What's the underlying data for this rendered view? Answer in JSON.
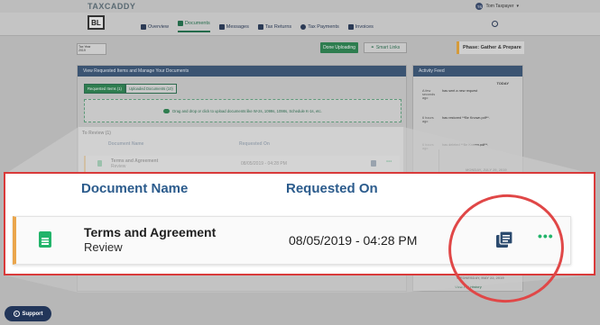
{
  "app": {
    "logo_text": "TAXCADDY",
    "firm_badge": "BL"
  },
  "user": {
    "initials": "TS",
    "name": "Tom Taxpayer"
  },
  "nav": {
    "items": [
      {
        "label": "Overview",
        "active": false
      },
      {
        "label": "Documents",
        "active": true
      },
      {
        "label": "Messages",
        "active": false
      },
      {
        "label": "Tax Returns",
        "active": false
      },
      {
        "label": "Tax Payments",
        "active": false
      },
      {
        "label": "Invoices",
        "active": false
      }
    ]
  },
  "subbar": {
    "tax_year_label": "Tax Year",
    "tax_year_value": "2019",
    "done_uploading": "Done Uploading",
    "smart_links": "Smart Links",
    "phase": "Phase: Gather & Prepare"
  },
  "main": {
    "header": "View Requested Items and Manage Your Documents",
    "tabs": [
      {
        "label": "Requested Items (1)",
        "active": true
      },
      {
        "label": "Uploaded Documents (10)",
        "active": false
      }
    ],
    "dropzone_text": "Drag and drop or click to upload documents like W-2s, 1099s, 1098s, Schedule K-1s, etc.",
    "to_review_title": "To Review (1)",
    "columns": {
      "document_name": "Document Name",
      "requested_on": "Requested On"
    },
    "rows": [
      {
        "name": "Terms and Agreement",
        "subtitle": "Review",
        "requested_on": "08/05/2019 - 04:28 PM"
      }
    ]
  },
  "activity": {
    "header": "Activity Feed",
    "today_label": "TODAY",
    "items": [
      {
        "time": "A few seconds ago",
        "text": "has sent a new request"
      },
      {
        "time": "6 hours ago",
        "text": "has restored **Be Known.pdf**."
      },
      {
        "time": "6 hours ago",
        "text": "has deleted **Be Known.pdf**."
      }
    ],
    "date1": "MONDAY, JULY 29, 2019",
    "date2": "WEDNESDAY, MAY 22, 2019",
    "view_full": "View Full History"
  },
  "support": {
    "label": "Support"
  },
  "icons": {
    "document": "document-icon",
    "copy": "copy-icon",
    "more": "more-icon",
    "search": "search-icon"
  },
  "colors": {
    "accent_green": "#22b46a",
    "header_blue": "#2b5b8c",
    "row_accent": "#eaa64c",
    "highlight_red": "#e04747"
  }
}
